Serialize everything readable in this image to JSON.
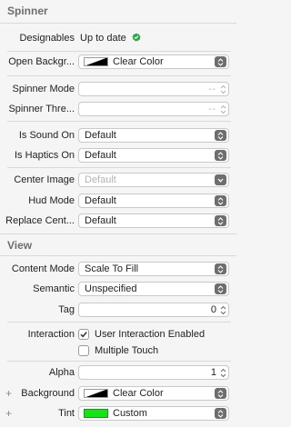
{
  "spinner_section": {
    "title": "Spinner",
    "designables_label": "Designables",
    "designables_value": "Up to date",
    "open_background_label": "Open Backgr...",
    "open_background_value": "Clear Color",
    "spinner_mode_label": "Spinner Mode",
    "spinner_mode_value": "--",
    "spinner_threshold_label": "Spinner Thre...",
    "spinner_threshold_value": "--",
    "is_sound_on_label": "Is Sound On",
    "is_sound_on_value": "Default",
    "is_haptics_on_label": "Is Haptics On",
    "is_haptics_on_value": "Default",
    "center_image_label": "Center Image",
    "center_image_placeholder": "Default",
    "hud_mode_label": "Hud Mode",
    "hud_mode_value": "Default",
    "replace_center_label": "Replace Cent...",
    "replace_center_value": "Default"
  },
  "view_section": {
    "title": "View",
    "content_mode_label": "Content Mode",
    "content_mode_value": "Scale To Fill",
    "semantic_label": "Semantic",
    "semantic_value": "Unspecified",
    "tag_label": "Tag",
    "tag_value": "0",
    "interaction_label": "Interaction",
    "user_interaction_label": "User Interaction Enabled",
    "user_interaction_checked": true,
    "multiple_touch_label": "Multiple Touch",
    "multiple_touch_checked": false,
    "alpha_label": "Alpha",
    "alpha_value": "1",
    "background_label": "Background",
    "background_value": "Clear Color",
    "tint_label": "Tint",
    "tint_value": "Custom",
    "plus_symbol": "+"
  },
  "colors": {
    "tint_swatch": "#11e611",
    "status_green": "#28a745"
  }
}
